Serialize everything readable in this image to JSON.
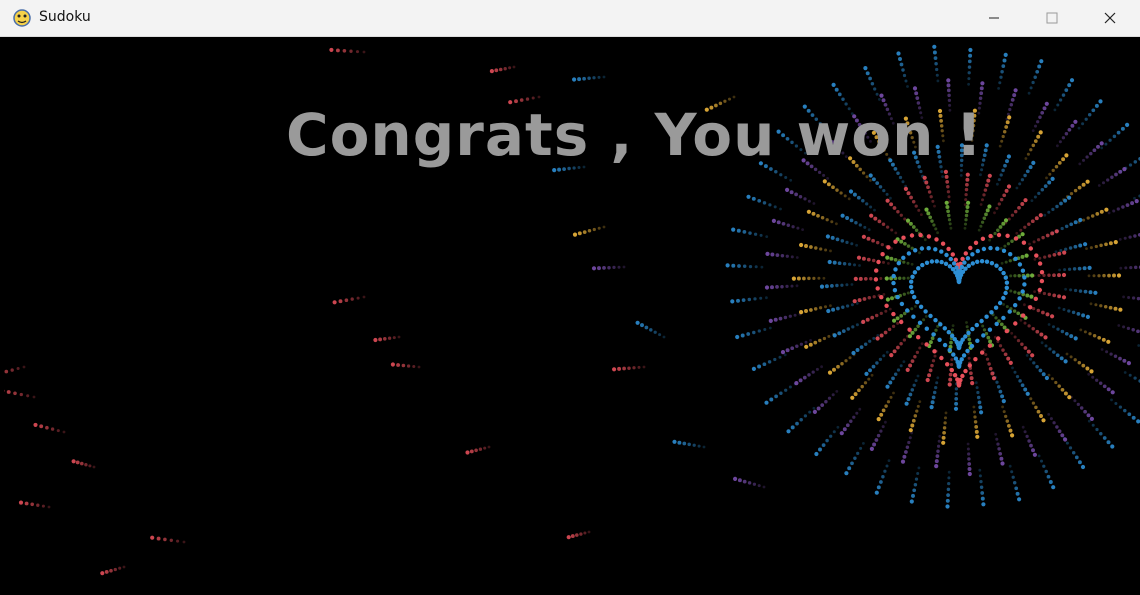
{
  "window": {
    "title": "Sudoku",
    "app_icon": "python-snake-icon",
    "controls": [
      "minimize-icon",
      "maximize-icon",
      "close-icon"
    ]
  },
  "game": {
    "message": "Congrats , You won !",
    "message_color": "#9a9a9a",
    "background": "#000000",
    "firework_colors": [
      "#e8505b",
      "#2d8fd5",
      "#7bc142",
      "#f2b83b",
      "#7a4fb0"
    ]
  }
}
